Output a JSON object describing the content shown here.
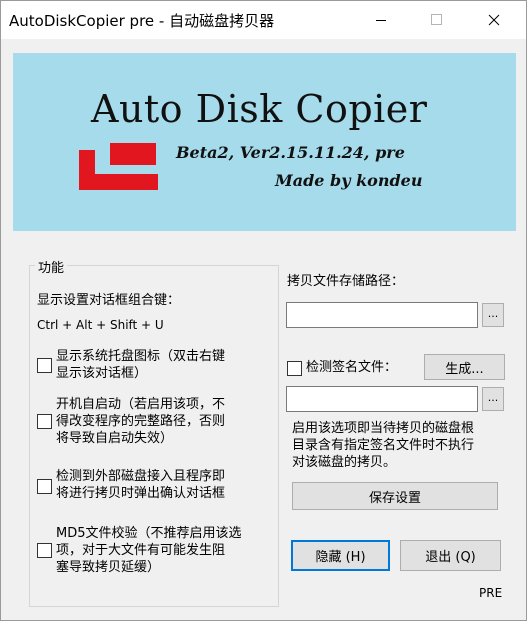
{
  "window": {
    "title": "AutoDiskCopier pre - 自动磁盘拷贝器",
    "controls": [
      "minimize-icon",
      "maximize-icon",
      "close-icon"
    ]
  },
  "banner": {
    "title": "Auto Disk Copier",
    "version_line": "Beta2, Ver2.15.11.24, pre",
    "author_line": "Made by kondeu",
    "background": "#a5dbea",
    "logo_color": "#e2161f"
  },
  "features": {
    "group_label": "功能",
    "hotkey_label": "显示设置对话框组合键：",
    "hotkey_value": "Ctrl + Alt + Shift + U",
    "options": [
      {
        "line1": "显示系统托盘图标（双击右键",
        "line2": "显示该对话框）",
        "checked": false
      },
      {
        "line1": "开机自启动（若启用该项，不",
        "line2": "得改变程序的完整路径，否则",
        "line3": "将导致自启动失效）",
        "checked": false
      },
      {
        "line1": "检测到外部磁盘接入且程序即",
        "line2": "将进行拷贝时弹出确认对话框",
        "checked": false
      },
      {
        "line1": "MD5文件校验（不推荐启用该选",
        "line2": "项，对于大文件有可能发生阻",
        "line3": "塞导致拷贝延缓）",
        "checked": false
      }
    ]
  },
  "storage": {
    "path_label": "拷贝文件存储路径：",
    "path_value": "",
    "browse_label": "...",
    "signature_label": "检测签名文件：",
    "signature_checked": false,
    "generate_label": "生成...",
    "signature_value": "",
    "browse2_label": "...",
    "description_1": "启用该选项即当待拷贝的磁盘根",
    "description_2": "目录含有指定签名文件时不执行",
    "description_3": "对该磁盘的拷贝。",
    "save_label": "保存设置"
  },
  "actions": {
    "hide_label": "隐藏 (H)",
    "exit_label": "退出 (Q)"
  },
  "status": {
    "edition": "PRE"
  }
}
